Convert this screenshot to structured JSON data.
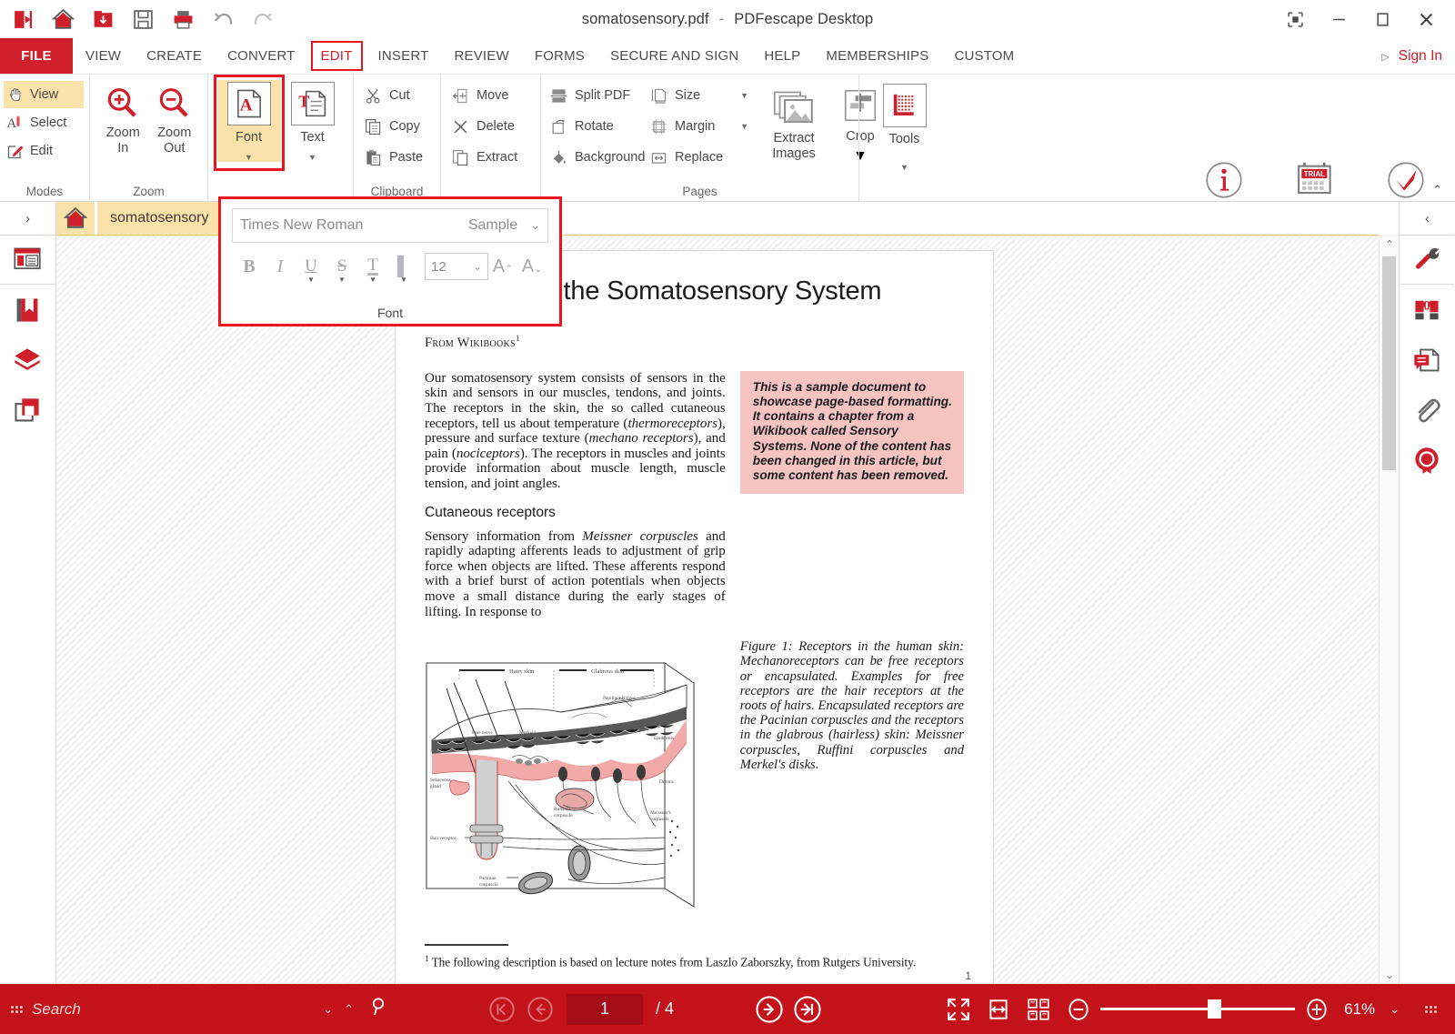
{
  "window": {
    "file_name": "somatosensory.pdf",
    "separator": "-",
    "app_name": "PDFescape Desktop",
    "controls": {
      "restore_pane": "restore-pane",
      "minimize": "minimize",
      "maximize": "maximize",
      "close": "close"
    }
  },
  "quick_access": [
    {
      "name": "export-icon",
      "label": "Export"
    },
    {
      "name": "home-icon",
      "label": "Home"
    },
    {
      "name": "open-icon",
      "label": "Open"
    },
    {
      "name": "save-icon",
      "label": "Save"
    },
    {
      "name": "print-icon",
      "label": "Print"
    },
    {
      "name": "undo-icon",
      "label": "Undo"
    },
    {
      "name": "redo-icon",
      "label": "Redo"
    }
  ],
  "menubar": {
    "file_label": "FILE",
    "items": [
      {
        "label": "VIEW",
        "active": false
      },
      {
        "label": "CREATE",
        "active": false
      },
      {
        "label": "CONVERT",
        "active": false
      },
      {
        "label": "EDIT",
        "active": true
      },
      {
        "label": "INSERT",
        "active": false
      },
      {
        "label": "REVIEW",
        "active": false
      },
      {
        "label": "FORMS",
        "active": false
      },
      {
        "label": "SECURE AND SIGN",
        "active": false
      },
      {
        "label": "HELP",
        "active": false
      },
      {
        "label": "MEMBERSHIPS",
        "active": false
      },
      {
        "label": "CUSTOM",
        "active": false
      }
    ],
    "sign_in": "Sign In"
  },
  "ribbon": {
    "groups": {
      "modes": {
        "label": "Modes",
        "items": [
          {
            "label": "View",
            "icon": "hand-icon",
            "active": true
          },
          {
            "label": "Select",
            "icon": "select-text-icon",
            "active": false
          },
          {
            "label": "Edit",
            "icon": "pencil-edit-icon",
            "active": false
          }
        ]
      },
      "zoom": {
        "label": "Zoom",
        "items": [
          {
            "label": "Zoom In",
            "line1": "Zoom",
            "line2": "In",
            "icon": "zoom-in-icon"
          },
          {
            "label": "Zoom Out",
            "line1": "Zoom",
            "line2": "Out",
            "icon": "zoom-out-icon"
          }
        ]
      },
      "font_text": {
        "font_label": "Font",
        "text_label": "Text"
      },
      "clipboard": {
        "label": "Clipboard",
        "items": [
          {
            "label": "Cut",
            "icon": "scissors-icon"
          },
          {
            "label": "Copy",
            "icon": "copy-icon"
          },
          {
            "label": "Paste",
            "icon": "paste-icon"
          }
        ]
      },
      "edit_ops": {
        "items": [
          {
            "label": "Move",
            "icon": "move-icon"
          },
          {
            "label": "Delete",
            "icon": "delete-x-icon"
          },
          {
            "label": "Extract",
            "icon": "extract-icon"
          }
        ]
      },
      "pages": {
        "label": "Pages",
        "col1": [
          {
            "label": "Split PDF",
            "icon": "split-pdf-icon"
          },
          {
            "label": "Rotate",
            "icon": "rotate-icon"
          },
          {
            "label": "Background",
            "icon": "background-icon"
          }
        ],
        "col2": [
          {
            "label": "Size",
            "icon": "page-size-icon",
            "dropdown": true
          },
          {
            "label": "Margin",
            "icon": "margin-icon",
            "dropdown": true
          },
          {
            "label": "Replace",
            "icon": "replace-icon",
            "dropdown": false
          }
        ],
        "big": [
          {
            "label": "Extract Images",
            "line1": "Extract",
            "line2": "Images",
            "icon": "extract-images-icon"
          },
          {
            "label": "Crop",
            "line1": "Crop",
            "line2": "",
            "icon": "crop-icon"
          }
        ]
      },
      "tools": {
        "label": "Tools",
        "button": "Tools",
        "icon": "tools-icon"
      }
    },
    "promo": [
      {
        "label": "More Info",
        "icon": "info-circle-icon"
      },
      {
        "label": "Free Trial",
        "icon": "calendar-trial-icon",
        "badge": "TRIAL"
      },
      {
        "label": "Upgrade",
        "icon": "check-circle-icon"
      }
    ]
  },
  "font_panel": {
    "font_name": "Times New Roman",
    "sample_label": "Sample",
    "size_value": "12",
    "group_label": "Font",
    "buttons": [
      {
        "name": "bold-button",
        "glyph": "B"
      },
      {
        "name": "italic-button",
        "glyph": "I"
      },
      {
        "name": "underline-button",
        "glyph": "U"
      },
      {
        "name": "strikethrough-button",
        "glyph": "S"
      },
      {
        "name": "text-color-button",
        "glyph": "T"
      },
      {
        "name": "highlight-color-button",
        "glyph": "▌"
      }
    ],
    "grow_label": "A",
    "shrink_label": "A"
  },
  "left_rail": {
    "toggle": "›",
    "items": [
      {
        "name": "sidebar-item-page-thumbnails",
        "active": true
      },
      {
        "name": "sidebar-item-bookmarks",
        "active": false
      },
      {
        "name": "sidebar-item-layers",
        "active": false
      },
      {
        "name": "sidebar-item-page-organize",
        "active": false
      }
    ]
  },
  "right_rail": {
    "toggle": "‹",
    "items": [
      {
        "name": "sidebar-item-tools",
        "active": true
      },
      {
        "name": "sidebar-item-search-binoculars",
        "active": false
      },
      {
        "name": "sidebar-item-comments",
        "active": false
      },
      {
        "name": "sidebar-item-attachments",
        "active": false
      },
      {
        "name": "sidebar-item-signatures",
        "active": false
      }
    ]
  },
  "tabs": {
    "home_tab": "home-tab",
    "document_tab": "somatosensory"
  },
  "document": {
    "title": "Anatomy of the Somatosensory System",
    "byline": "From Wikibooks",
    "byline_sup": "1",
    "paragraph_1": "Our somatosensory system consists of sensors in the skin and sensors in our muscles, tendons, and joints. The receptors in the skin, the so called cutaneous receptors, tell us about temperature (thermoreceptors), pressure and surface texture (mechano receptors), and pain (nociceptors). The receptors in muscles and joints provide information about muscle length, muscle tension, and joint angles.",
    "section_heading": "Cutaneous receptors",
    "paragraph_2": "Sensory information from Meissner corpuscles and rapidly adapting afferents leads to adjustment of grip force when objects are lifted. These afferents respond with a brief burst of action potentials when objects move a small distance during the early stages of lifting. In response to",
    "callout": "This is a sample document to showcase page-based formatting. It contains a chapter from a Wikibook called Sensory Systems. None of the content has been changed in this article, but some content has been removed.",
    "figure_caption": "Figure 1: Receptors in the human skin: Mechanoreceptors can be free receptors or encapsulated. Examples for free receptors are the hair receptors at the roots of hairs. Encapsulated receptors are the Pacinian corpuscles and the receptors in the glabrous (hairless) skin: Meissner corpuscles, Ruffini corpuscles and Merkel's disks.",
    "footnote": "The following description is based on lecture notes from Laszlo Zaborszky, from Rutgers University.",
    "footnote_sup": "1",
    "page_number": "1",
    "figure_labels": {
      "hairy_skin": "Hairy skin",
      "glabrous_skin": "Glabrous skin",
      "papillary_ridges": "Papillary Ridges",
      "free_nerve": "Free nerve ending",
      "merkel": "Merkel's receptor",
      "septa": "Septa",
      "epidermis": "Epidermis",
      "dermis": "Dermis",
      "sebaceous": "Sebaceous gland",
      "hair_receptor": "Hair receptor",
      "ruffini": "Ruffini's corpuscle",
      "meissner": "Meissner's corpuscle",
      "pacinian": "Pacinian corpuscle"
    }
  },
  "statusbar": {
    "search_placeholder": "Search",
    "page_current": "1",
    "page_total": "/ 4",
    "zoom_percent": "61%",
    "icons": {
      "prev_page": "previous-page-icon",
      "next_page": "next-page-icon",
      "first_page": "first-page-icon",
      "last_page": "last-page-icon",
      "fit_page": "fit-page-icon",
      "fit_width": "fit-width-icon",
      "page_layout": "page-layout-icon",
      "zoom_out": "zoom-out-icon",
      "zoom_in": "zoom-in-icon"
    }
  },
  "colors": {
    "brand_red": "#cf1f2a",
    "status_red": "#c4121b",
    "highlight_yellow": "#fbe2a8",
    "selection_red": "#e8161f",
    "callout_pink": "#f6c3c3"
  }
}
